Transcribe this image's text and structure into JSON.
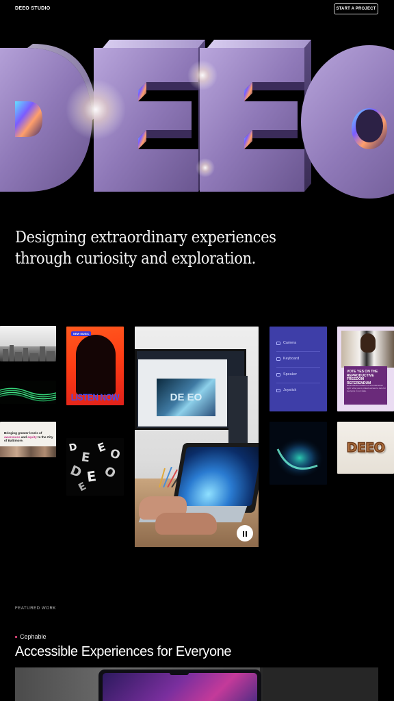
{
  "header": {
    "brand": "DEEO STUDIO",
    "cta_label": "START A PROJECT"
  },
  "hero": {
    "letters": "DEEO",
    "tagline_line1": "Designing extraordinary experiences",
    "tagline_line2": "through curiosity and exploration."
  },
  "gallery": {
    "baltimore_text_pre": "Bringing greater levels of ",
    "baltimore_hl1": "awareness",
    "baltimore_mid": " and ",
    "baltimore_hl2": "equity",
    "baltimore_post": " to the City of Baltimore.",
    "listen_badge": "NEW MUSIC",
    "listen_label": "LISTEN NOW",
    "monitor_card": "DE EO",
    "menu_items": [
      "Camera",
      "Keyboard",
      "Speaker",
      "Joystick"
    ],
    "vote_title": "VOTE YES ON THE REPRODUCTIVE FREEDOM REFERENDUM",
    "vote_body": "Reproductive freedom is a fundamental right. Vote yes to protect access to care for everyone in our state.",
    "deeo_small": "DEEO",
    "collage_letters": [
      "D",
      "E",
      "E",
      "O",
      "D",
      "E",
      "O",
      "E"
    ],
    "pause_icon": "pause-icon"
  },
  "featured": {
    "section_label": "FEATURED WORK",
    "client": "Cephable",
    "title": "Accessible Experiences for Everyone"
  },
  "colors": {
    "background": "#000000",
    "accent_dot": "#ff4f8a",
    "menu_panel": "#3e3ea8",
    "listen_orange": "#ff4a1a"
  }
}
